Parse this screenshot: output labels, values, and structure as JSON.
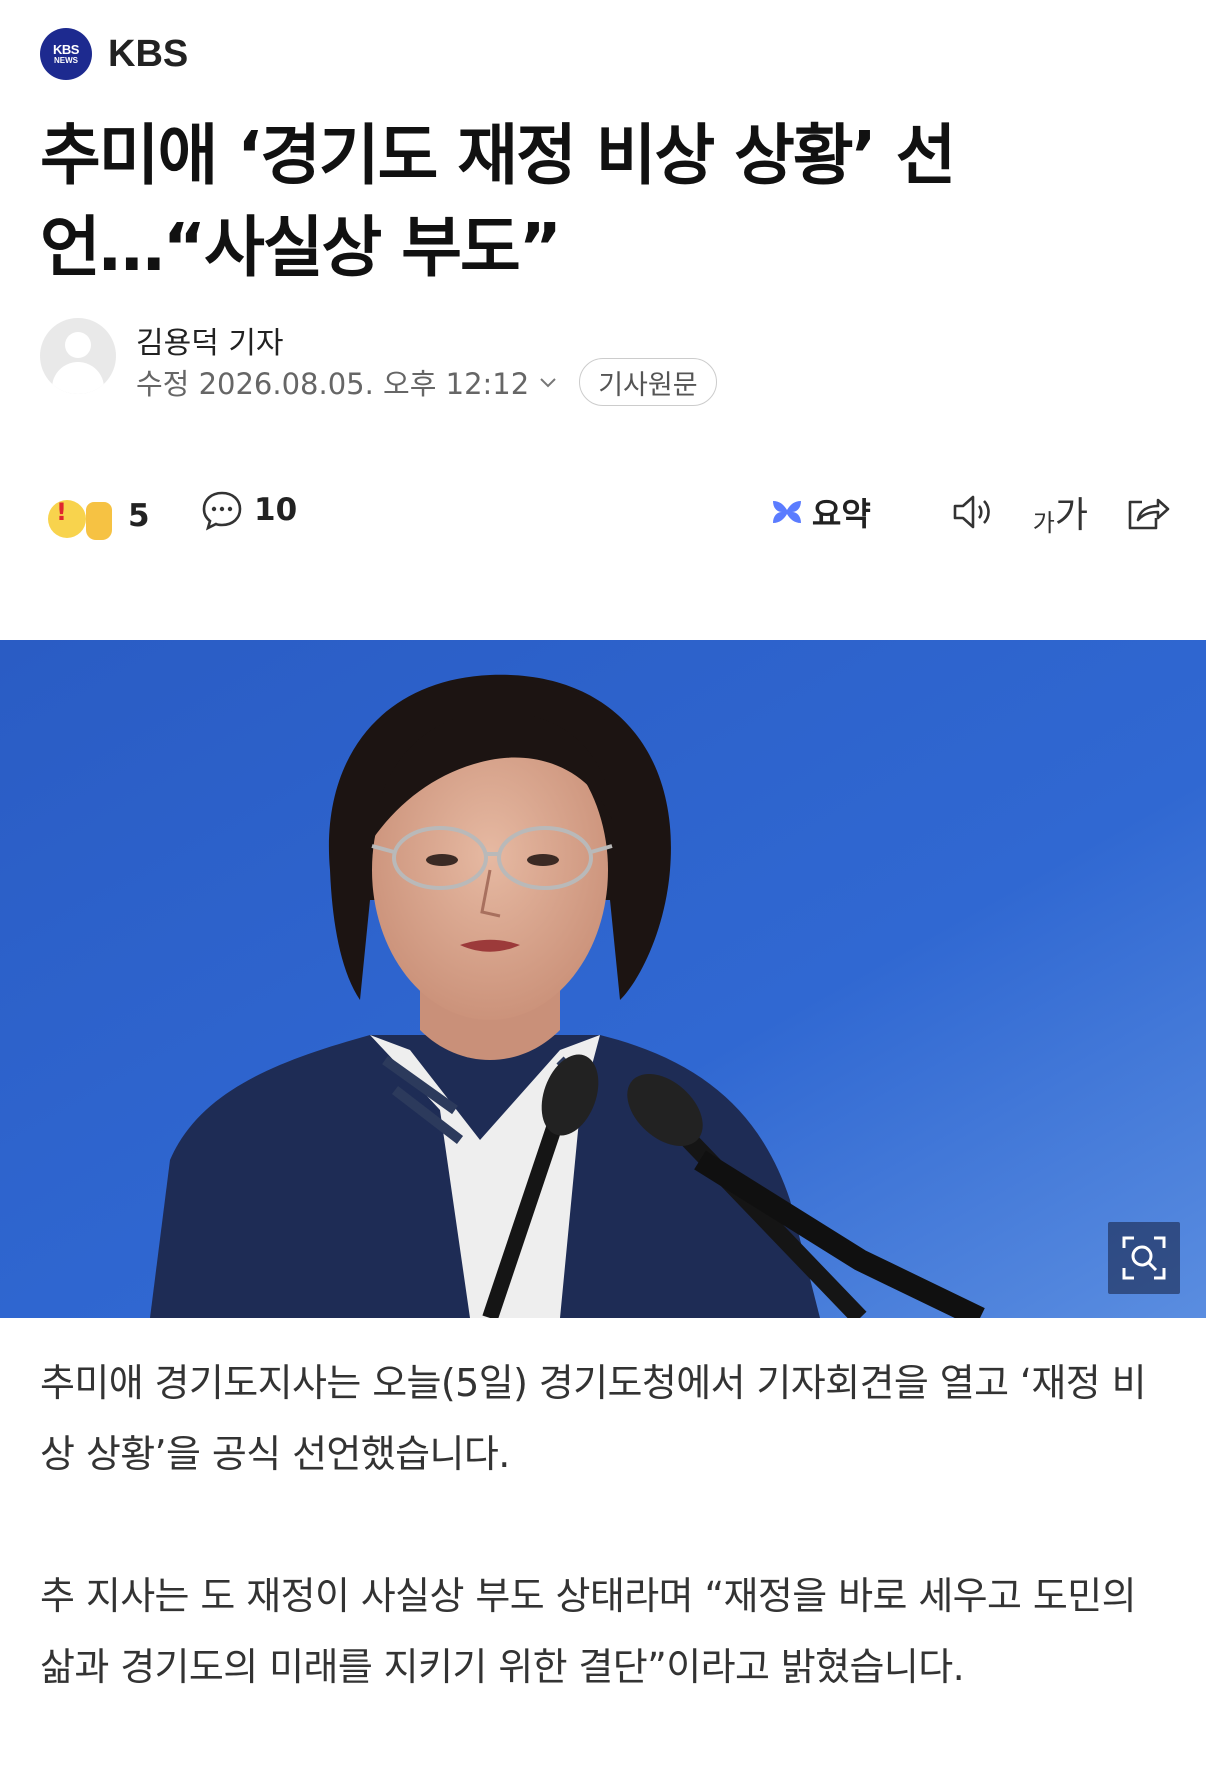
{
  "press": {
    "logo_line1": "KBS",
    "logo_line2": "NEWS",
    "name": "KBS"
  },
  "headline": "추미애 ‘경기도 재정 비상 상황’ 선언…“사실상 부도”",
  "byline": {
    "reporter": "김용덕 기자",
    "date": "수정 2026.08.05. 오후 12:12",
    "original_button": "기사원문"
  },
  "actions": {
    "reaction_count": "5",
    "comment_count": "10",
    "summary_label": "요약",
    "font_small": "가",
    "font_large": "가"
  },
  "photo": {
    "icon": "zoom-icon",
    "background_color": "#2e64cc"
  },
  "body": {
    "paragraph1": "추미애 경기도지사는 오늘(5일) 경기도청에서 기자회견을 열고 ‘재정 비상 상황’을 공식 선언했습니다.",
    "paragraph2": "추 지사는 도 재정이 사실상 부도 상태라며 “재정을 바로 세우고 도민의 삶과 경기도의 미래를 지키기 위한 결단”이라고 밝혔습니다."
  },
  "colors": {
    "brand": "#1d2a8f",
    "summary_accent": "#5b7cff"
  }
}
